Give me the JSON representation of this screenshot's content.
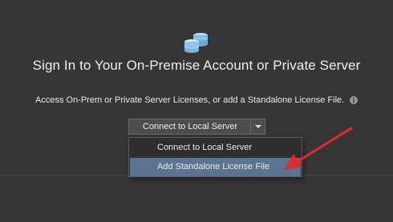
{
  "header": {
    "icon": "database-icon",
    "title": "Sign In to Your On-Premise Account or Private Server",
    "subtitle": "Access On-Prem or Private Server Licenses, or add a Standalone License File."
  },
  "split_button": {
    "label": "Connect to Local Server",
    "arrow_icon": "chevron-down-icon"
  },
  "dropdown": {
    "items": [
      {
        "label": "Connect to Local Server",
        "highlighted": false
      },
      {
        "label": "Add Standalone License File",
        "highlighted": true
      }
    ]
  },
  "annotation": {
    "type": "arrow",
    "color": "#e8262d",
    "points_to": "Add Standalone License File"
  },
  "colors": {
    "background": "#363636",
    "highlight": "#5a7491",
    "accent_icon": "#8fc4ec"
  }
}
